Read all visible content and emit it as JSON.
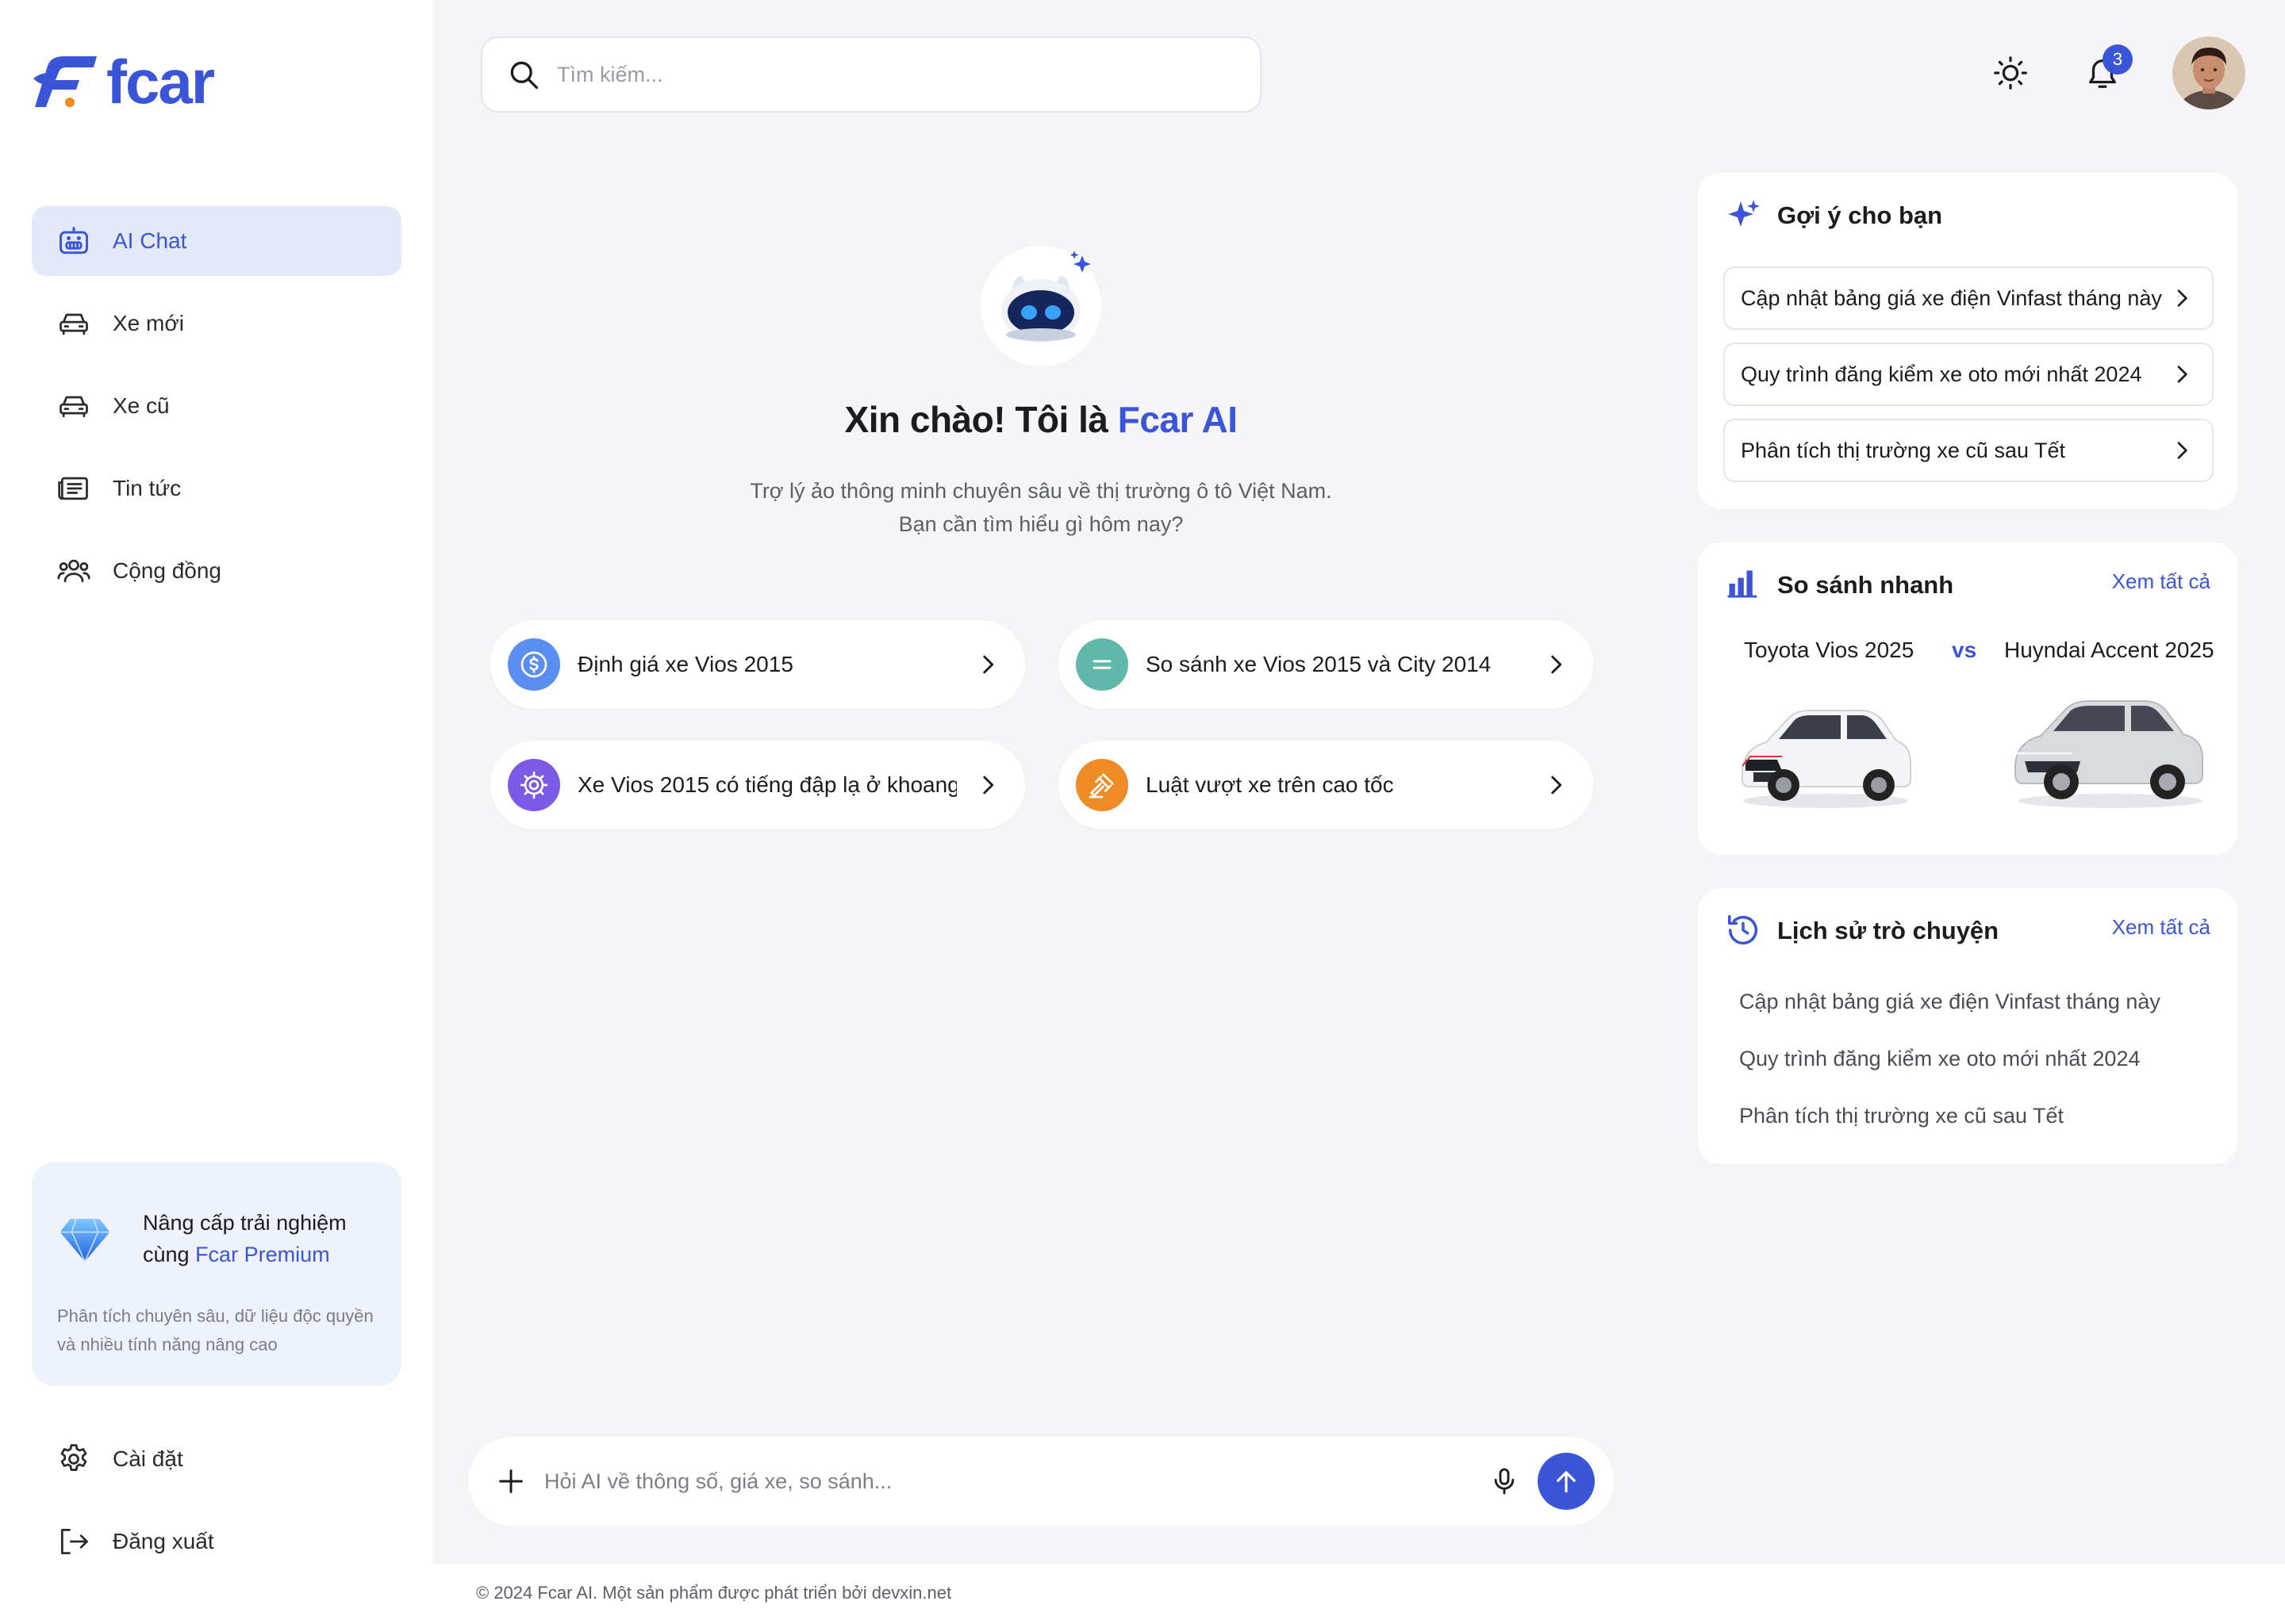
{
  "brand": {
    "name": "fcar",
    "accent": "#3b55d9"
  },
  "sidebar": {
    "items": [
      {
        "label": "AI Chat",
        "icon": "robot-icon",
        "active": true
      },
      {
        "label": "Xe mới",
        "icon": "car-icon"
      },
      {
        "label": "Xe cũ",
        "icon": "car-icon"
      },
      {
        "label": "Tin tức",
        "icon": "news-icon"
      },
      {
        "label": "Cộng đồng",
        "icon": "community-icon"
      }
    ],
    "premium": {
      "line1": "Nâng cấp trải nghiệm",
      "line2_prefix": "cùng ",
      "line2_accent": "Fcar Premium",
      "desc": "Phân tích chuyên sâu, dữ liệu độc quyền và nhiều tính năng nâng cao"
    },
    "bottom": [
      {
        "label": "Cài đặt",
        "icon": "gear-icon"
      },
      {
        "label": "Đăng xuất",
        "icon": "logout-icon"
      }
    ]
  },
  "header": {
    "search_placeholder": "Tìm kiếm...",
    "notification_count": "3"
  },
  "hero": {
    "greeting_prefix": "Xin chào! Tôi là ",
    "greeting_accent": "Fcar AI",
    "subtitle_line1": "Trợ lý ảo thông minh chuyên sâu về thị trường ô tô Việt Nam.",
    "subtitle_line2": "Bạn cần tìm hiểu gì hôm nay?"
  },
  "quick_prompts": [
    {
      "label": "Định giá xe Vios 2015",
      "icon": "dollar-icon",
      "color": "#5a8ef2"
    },
    {
      "label": "So sánh xe Vios 2015 và City 2014",
      "icon": "equals-icon",
      "color": "#5fb8a8"
    },
    {
      "label": "Xe Vios 2015 có tiếng đập lạ ở khoang",
      "icon": "engine-icon",
      "color": "#7b5ae6"
    },
    {
      "label": "Luật vượt xe trên cao tốc",
      "icon": "gavel-icon",
      "color": "#f08a24"
    }
  ],
  "chat_input": {
    "placeholder": "Hỏi AI về thông số, giá xe, so sánh..."
  },
  "footer": {
    "text": "© 2024 Fcar AI. Một sản phẩm được phát triển bởi devxin.net"
  },
  "suggestions": {
    "title": "Gợi ý cho bạn",
    "items": [
      "Cập nhật bảng giá xe điện Vinfast tháng này",
      "Quy trình  đăng kiểm xe oto mới nhất 2024",
      "Phân tích thị trường xe cũ sau Tết"
    ]
  },
  "compare": {
    "title": "So sánh nhanh",
    "see_all": "Xem tất cả",
    "left": "Toyota Vios 2025",
    "vs": "vs",
    "right": "Huyndai Accent 2025"
  },
  "history": {
    "title": "Lịch sử trò chuyện",
    "see_all": "Xem tất cả",
    "items": [
      "Cập nhật bảng giá xe điện Vinfast tháng này",
      "Quy trình  đăng kiểm xe oto mới nhất 2024",
      "Phân tích thị trường xe cũ sau Tết"
    ]
  }
}
